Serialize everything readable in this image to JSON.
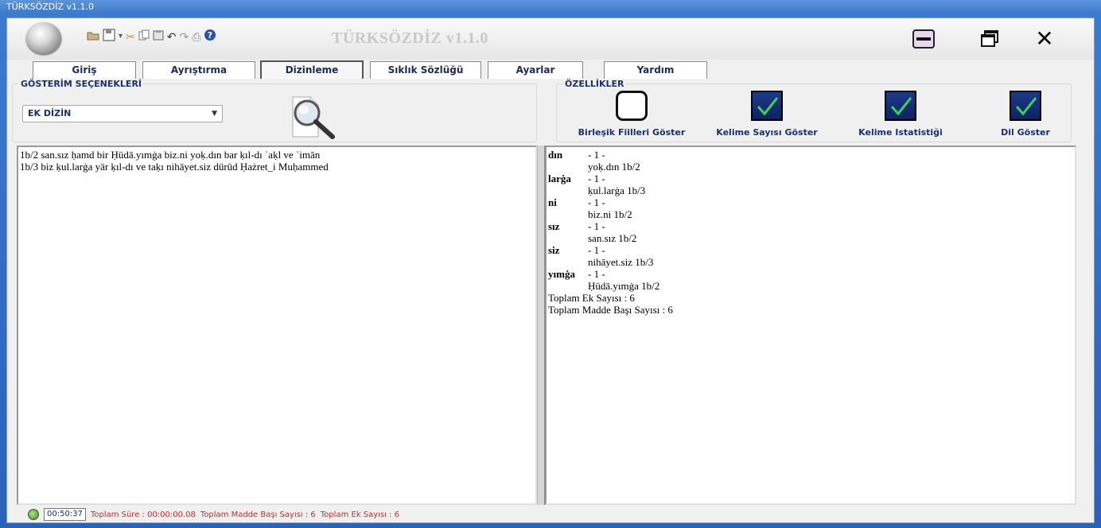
{
  "window": {
    "title": "TÜRKSÖZDİZ v1.1.0"
  },
  "header": {
    "app_title": "TÜRKSÖZDİZ v1.1.0",
    "quick_access_icons": [
      "open-icon",
      "save-icon",
      "dropdown-icon",
      "cut-icon",
      "copy-icon",
      "paste-icon",
      "undo-icon",
      "redo-icon",
      "print-icon",
      "help-icon"
    ]
  },
  "tabs": [
    {
      "label": "Giriş",
      "active": false
    },
    {
      "label": "Ayrıştırma",
      "active": false
    },
    {
      "label": "Dizinleme",
      "active": true
    },
    {
      "label": "Sıklık Sözlüğü",
      "active": false
    },
    {
      "label": "Ayarlar",
      "active": false
    },
    {
      "label": "Yardım",
      "active": false
    }
  ],
  "options": {
    "display_group_title": "GÖSTERİM SEÇENEKLERİ",
    "display_selected": "EK DİZİN",
    "features_group_title": "ÖZELLİKLER",
    "features": [
      {
        "label": "Birleşik Fiilleri Göster",
        "checked": false
      },
      {
        "label": "Kelime Sayısı Göster",
        "checked": true
      },
      {
        "label": "Kelime Istatistiği",
        "checked": true
      },
      {
        "label": "Dil Göster",
        "checked": true
      }
    ]
  },
  "source_text": [
    "1b/2 san.sız ḥamd bir Ḥüdā.yımġa biz.ni yoḳ.dın bar ḳıl-dı ʿaḳl ve ʿimān",
    "1b/3 biz ḳul.larġa yār ḳıl-dı ve taḳı nihāyet.siz dürūd Ḥażret_i Muḥammed"
  ],
  "index": {
    "entries": [
      {
        "suffix": "dın",
        "count": "- 1 -",
        "occurrence": "yoḳ.dın 1b/2"
      },
      {
        "suffix": "larġa",
        "count": "- 1 -",
        "occurrence": "ḳul.larġa 1b/3"
      },
      {
        "suffix": "ni",
        "count": "- 1 -",
        "occurrence": "biz.ni 1b/2"
      },
      {
        "suffix": "sız",
        "count": "- 1 -",
        "occurrence": "san.sız 1b/2"
      },
      {
        "suffix": "siz",
        "count": "- 1 -",
        "occurrence": "nihāyet.siz 1b/3"
      },
      {
        "suffix": "yımġa",
        "count": "- 1 -",
        "occurrence": "Ḥüdā.yımġa 1b/2"
      }
    ],
    "total_suffix": "Toplam Ek Sayısı : 6",
    "total_headword": "Toplam Madde Başı Sayısı : 6"
  },
  "status": {
    "time": "00:50:37",
    "duration": "Toplam Süre : 00:00:00.08",
    "headword_count": "Toplam Madde Başı Sayısı : 6",
    "suffix_count": "Toplam Ek Sayısı : 6"
  },
  "colors": {
    "accent": "#1e2f6e",
    "status_red": "#c0302a",
    "checkbox_blue": "#1d3a8a"
  }
}
